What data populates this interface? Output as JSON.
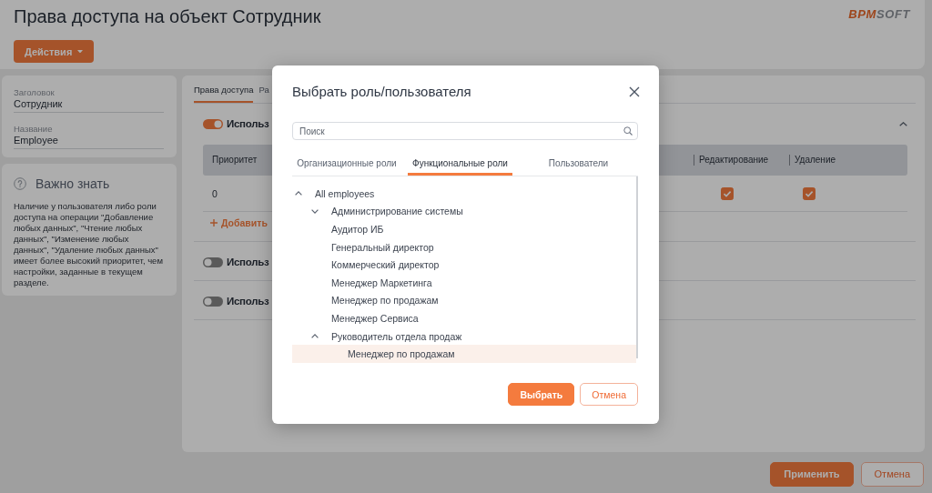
{
  "header": {
    "title": "Права доступа на объект Сотрудник",
    "logo": {
      "accent": "BPM",
      "rest": "SOFT"
    },
    "actions_button": "Действия"
  },
  "object_card": {
    "fields": [
      {
        "label": "Заголовок",
        "value": "Сотрудник"
      },
      {
        "label": "Название",
        "value": "Employee"
      }
    ]
  },
  "info_card": {
    "title": "Важно знать",
    "text": "Наличие у пользователя либо роли доступа на операции \"Добавление любых данных\", \"Чтение любых данных\", \"Изменение любых данных\", \"Удаление любых данных\" имеет более высокий приоритет, чем настройки, заданные в текущем разделе."
  },
  "rights_panel": {
    "tabs": [
      {
        "label": "Права доступа",
        "selected": true
      },
      {
        "label": "Ра",
        "selected": false
      }
    ],
    "sections": [
      {
        "title": "Использ",
        "on": true,
        "expanded": true,
        "table": {
          "columns": [
            "Приоритет",
            "Редактирование",
            "Удаление"
          ],
          "rows": [
            {
              "cells": [
                {
                  "kind": "text",
                  "text": "0"
                },
                {
                  "kind": "checkbox",
                  "checked": true
                },
                {
                  "kind": "checkbox",
                  "checked": true
                }
              ]
            }
          ]
        },
        "add_button": "Добавить"
      },
      {
        "title": "Использ",
        "on": false
      },
      {
        "title": "Использ",
        "on": false
      }
    ]
  },
  "footer": {
    "buttons": [
      {
        "label": "Применить",
        "kind": "primary"
      },
      {
        "label": "Отмена",
        "kind": "secondary"
      }
    ]
  },
  "dialog": {
    "title": "Выбрать роль/пользователя",
    "search": {
      "placeholder": "Поиск"
    },
    "tabs": [
      {
        "label": "Организационные роли",
        "selected": false
      },
      {
        "label": "Функциональные роли",
        "selected": true
      },
      {
        "label": "Пользователи",
        "selected": false
      }
    ],
    "tree": [
      {
        "kind": "group",
        "label": "All employees",
        "expanded": true,
        "selected": false,
        "children": [
          {
            "kind": "group",
            "label": "Администрирование системы",
            "expanded": false,
            "selected": false
          },
          {
            "kind": "role",
            "label": "Аудитор ИБ",
            "selected": false
          },
          {
            "kind": "role",
            "label": "Генеральный директор",
            "selected": false
          },
          {
            "kind": "role",
            "label": "Коммерческий директор",
            "selected": false
          },
          {
            "kind": "role",
            "label": "Менеджер Маркетинга",
            "selected": false
          },
          {
            "kind": "role",
            "label": "Менеджер по продажам",
            "selected": false
          },
          {
            "kind": "role",
            "label": "Менеджер Сервиса",
            "selected": false
          },
          {
            "kind": "group",
            "label": "Руководитель отдела продаж",
            "expanded": true,
            "selected": false,
            "children": [
              {
                "kind": "role",
                "label": "Менеджер по продажам",
                "selected": true
              }
            ]
          }
        ]
      }
    ],
    "buttons": [
      {
        "label": "Выбрать",
        "kind": "primary"
      },
      {
        "label": "Отмена",
        "kind": "secondary"
      }
    ]
  }
}
